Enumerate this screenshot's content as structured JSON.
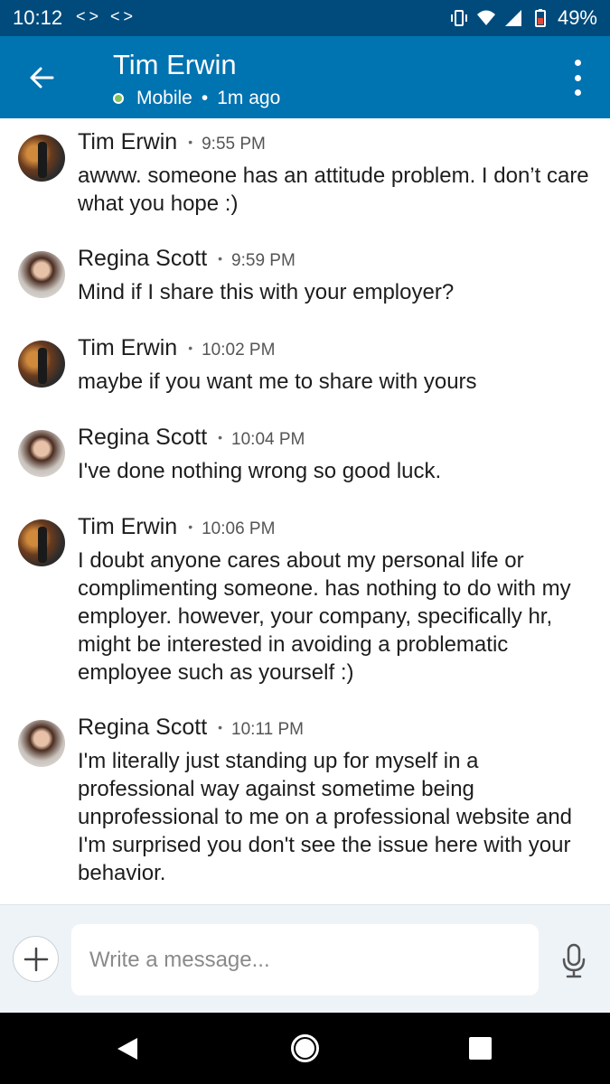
{
  "status_bar": {
    "time": "10:12",
    "left_icons": "<> <>",
    "battery_percent": "49%"
  },
  "header": {
    "title": "Tim Erwin",
    "status": "Mobile",
    "last_seen": "1m ago"
  },
  "messages": [
    {
      "sender": "Tim Erwin",
      "time": "9:55 PM",
      "text": "awww. someone has an attitude problem. I don’t care what you hope :)",
      "avatar": "tim"
    },
    {
      "sender": "Regina Scott",
      "time": "9:59 PM",
      "text": "Mind if I share this with your employer?",
      "avatar": "regina"
    },
    {
      "sender": "Tim Erwin",
      "time": "10:02 PM",
      "text": "maybe if you want me to share with yours",
      "avatar": "tim"
    },
    {
      "sender": "Regina Scott",
      "time": "10:04 PM",
      "text": "I've done nothing wrong so good luck.",
      "avatar": "regina"
    },
    {
      "sender": "Tim Erwin",
      "time": "10:06 PM",
      "text": "I doubt anyone cares about my personal life or complimenting someone. has nothing to do with my employer. however, your company, specifically hr, might be interested in avoiding a problematic employee such as yourself :)",
      "avatar": "tim"
    },
    {
      "sender": "Regina Scott",
      "time": "10:11 PM",
      "text": "I'm literally just standing up for myself in a professional way against sometime being unprofessional to me on a professional website and I'm surprised you don't see the issue here with your behavior.",
      "avatar": "regina"
    }
  ],
  "composer": {
    "placeholder": "Write a message..."
  },
  "colors": {
    "status_bar": "#004b7c",
    "app_bar": "#0073b1",
    "online": "#7fc15e",
    "composer_bg": "#eef3f8"
  }
}
